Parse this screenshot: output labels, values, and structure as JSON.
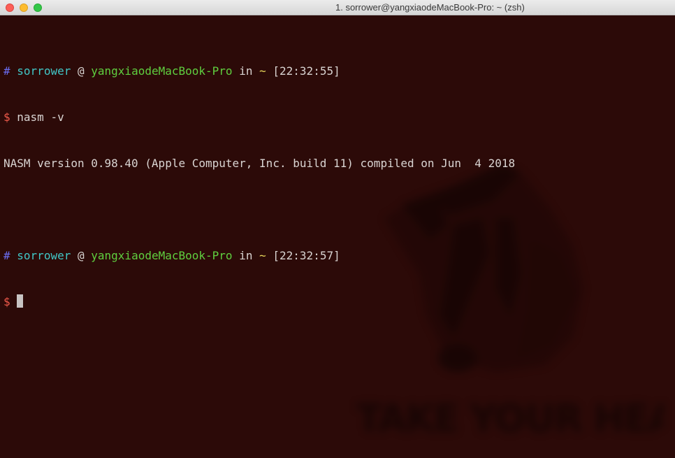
{
  "window": {
    "title": "1. sorrower@yangxiaodeMacBook-Pro: ~ (zsh)"
  },
  "terminal": {
    "prompt1": {
      "hash": "#",
      "user": "sorrower",
      "at": "@",
      "host": "yangxiaodeMacBook-Pro",
      "in": "in",
      "dir": "~",
      "time": "[22:32:55]"
    },
    "command1": {
      "dollar": "$",
      "text": "nasm -v"
    },
    "output1": "NASM version 0.98.40 (Apple Computer, Inc. build 11) compiled on Jun  4 2018",
    "prompt2": {
      "hash": "#",
      "user": "sorrower",
      "at": "@",
      "host": "yangxiaodeMacBook-Pro",
      "in": "in",
      "dir": "~",
      "time": "[22:32:57]"
    },
    "command2": {
      "dollar": "$"
    }
  },
  "background_image": {
    "icon": "top-hat-mascot-icon",
    "text": "TAKE YOUR HEART"
  },
  "colors": {
    "background": "#2c0a08",
    "user": "#41c7c7",
    "host": "#5fcf3f",
    "hash": "#6a6cf0",
    "dollar": "#f05a4b",
    "tilde": "#e8d75b"
  }
}
